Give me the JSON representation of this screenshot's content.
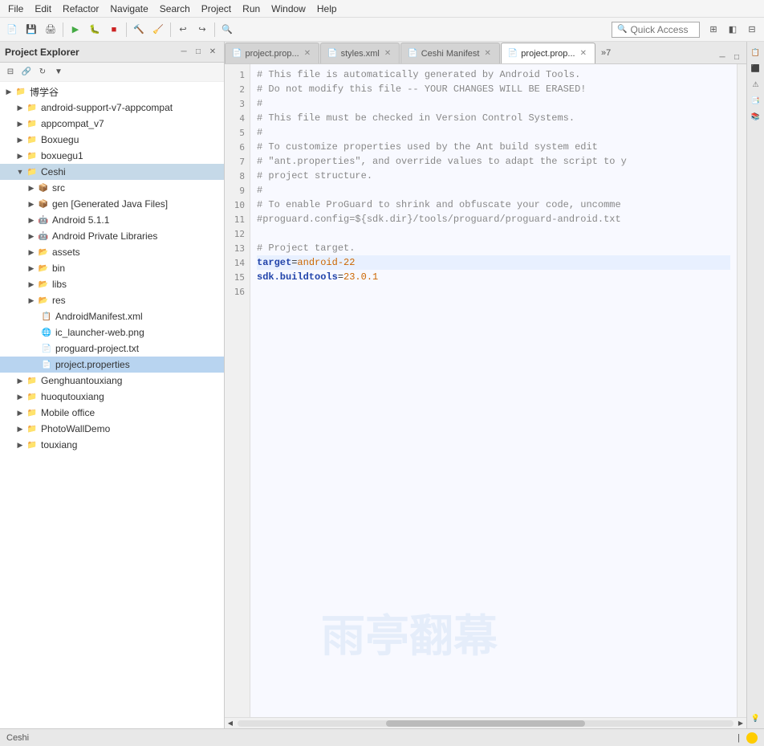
{
  "menubar": {
    "items": [
      "File",
      "Edit",
      "Refactor",
      "Navigate",
      "Search",
      "Project",
      "Run",
      "Window",
      "Help"
    ]
  },
  "toolbar": {
    "quick_access_placeholder": "Quick Access",
    "quick_access_label": "Quick Access"
  },
  "project_explorer": {
    "title": "Project Explorer",
    "close_icon": "✕",
    "minimize_icon": "─",
    "maximize_icon": "□",
    "tree_items": [
      {
        "id": "博学谷",
        "label": "博学谷",
        "indent": 0,
        "type": "project",
        "expanded": true
      },
      {
        "id": "android-support-v7-appcompat",
        "label": "android-support-v7-appcompat",
        "indent": 1,
        "type": "project"
      },
      {
        "id": "appcompat_v7",
        "label": "appcompat_v7",
        "indent": 1,
        "type": "project"
      },
      {
        "id": "Boxuegu",
        "label": "Boxuegu",
        "indent": 1,
        "type": "project"
      },
      {
        "id": "boxuegu1",
        "label": "boxuegu1",
        "indent": 1,
        "type": "project"
      },
      {
        "id": "Ceshi",
        "label": "Ceshi",
        "indent": 1,
        "type": "project",
        "expanded": true,
        "selected": true
      },
      {
        "id": "src",
        "label": "src",
        "indent": 2,
        "type": "src"
      },
      {
        "id": "gen",
        "label": "gen [Generated Java Files]",
        "indent": 2,
        "type": "gen"
      },
      {
        "id": "Android511",
        "label": "Android 5.1.1",
        "indent": 2,
        "type": "lib"
      },
      {
        "id": "AndroidPrivate",
        "label": "Android Private Libraries",
        "indent": 2,
        "type": "lib"
      },
      {
        "id": "assets",
        "label": "assets",
        "indent": 2,
        "type": "folder"
      },
      {
        "id": "bin",
        "label": "bin",
        "indent": 2,
        "type": "folder"
      },
      {
        "id": "libs",
        "label": "libs",
        "indent": 2,
        "type": "folder"
      },
      {
        "id": "res",
        "label": "res",
        "indent": 2,
        "type": "folder"
      },
      {
        "id": "AndroidManifest",
        "label": "AndroidManifest.xml",
        "indent": 2,
        "type": "file-xml"
      },
      {
        "id": "ic_launcher",
        "label": "ic_launcher-web.png",
        "indent": 2,
        "type": "file-img"
      },
      {
        "id": "proguard",
        "label": "proguard-project.txt",
        "indent": 2,
        "type": "file-txt"
      },
      {
        "id": "project-props",
        "label": "project.properties",
        "indent": 2,
        "type": "file-txt",
        "active": true
      },
      {
        "id": "Genghuantouxiang",
        "label": "Genghuantouxiang",
        "indent": 1,
        "type": "project"
      },
      {
        "id": "huoqutouxiang",
        "label": "huoqutouxiang",
        "indent": 1,
        "type": "project"
      },
      {
        "id": "Mobile-office",
        "label": "Mobile office",
        "indent": 1,
        "type": "project"
      },
      {
        "id": "PhotoWallDemo",
        "label": "PhotoWallDemo",
        "indent": 1,
        "type": "project"
      },
      {
        "id": "touxiang",
        "label": "touxiang",
        "indent": 1,
        "type": "project"
      }
    ]
  },
  "editor": {
    "tabs": [
      {
        "id": "tab1",
        "label": "project.prop...",
        "icon": "📄",
        "active": false
      },
      {
        "id": "tab2",
        "label": "styles.xml",
        "icon": "📄",
        "active": false
      },
      {
        "id": "tab3",
        "label": "Ceshi Manifest",
        "icon": "📄",
        "active": false
      },
      {
        "id": "tab4",
        "label": "project.prop...",
        "icon": "📄",
        "active": true
      }
    ],
    "tab_overflow": "»7",
    "lines": [
      {
        "num": "1",
        "content": "# This file is automatically generated by Android Tools.",
        "class": "c-comment"
      },
      {
        "num": "2",
        "content": "# Do not modify this file -- YOUR CHANGES WILL BE ERASED!",
        "class": "c-comment"
      },
      {
        "num": "3",
        "content": "#",
        "class": "c-comment"
      },
      {
        "num": "4",
        "content": "# This file must be checked in Version Control Systems.",
        "class": "c-comment"
      },
      {
        "num": "5",
        "content": "#",
        "class": "c-comment"
      },
      {
        "num": "6",
        "content": "# To customize properties used by the Ant build system edit",
        "class": "c-comment"
      },
      {
        "num": "7",
        "content": "# \"ant.properties\", and override values to adapt the script to y",
        "class": "c-comment"
      },
      {
        "num": "8",
        "content": "# project structure.",
        "class": "c-comment"
      },
      {
        "num": "9",
        "content": "#",
        "class": "c-comment"
      },
      {
        "num": "10",
        "content": "# To enable ProGuard to shrink and obfuscate your code, uncomme",
        "class": "c-comment"
      },
      {
        "num": "11",
        "content": "#proguard.config=${sdk.dir}/tools/proguard/proguard-android.txt",
        "class": "c-comment"
      },
      {
        "num": "12",
        "content": "",
        "class": ""
      },
      {
        "num": "13",
        "content": "# Project target.",
        "class": "c-comment"
      },
      {
        "num": "14",
        "content": "target=android-22",
        "class": "c-key-val",
        "key": "target",
        "val": "android-22"
      },
      {
        "num": "15",
        "content": "sdk.buildtools=23.0.1",
        "class": "c-key-val",
        "key": "sdk.buildtools",
        "val": "23.0.1"
      },
      {
        "num": "16",
        "content": "",
        "class": ""
      }
    ]
  },
  "status_bar": {
    "project_name": "Ceshi",
    "separator": "|"
  },
  "watermark": {
    "text": "雨亭翻幕"
  }
}
